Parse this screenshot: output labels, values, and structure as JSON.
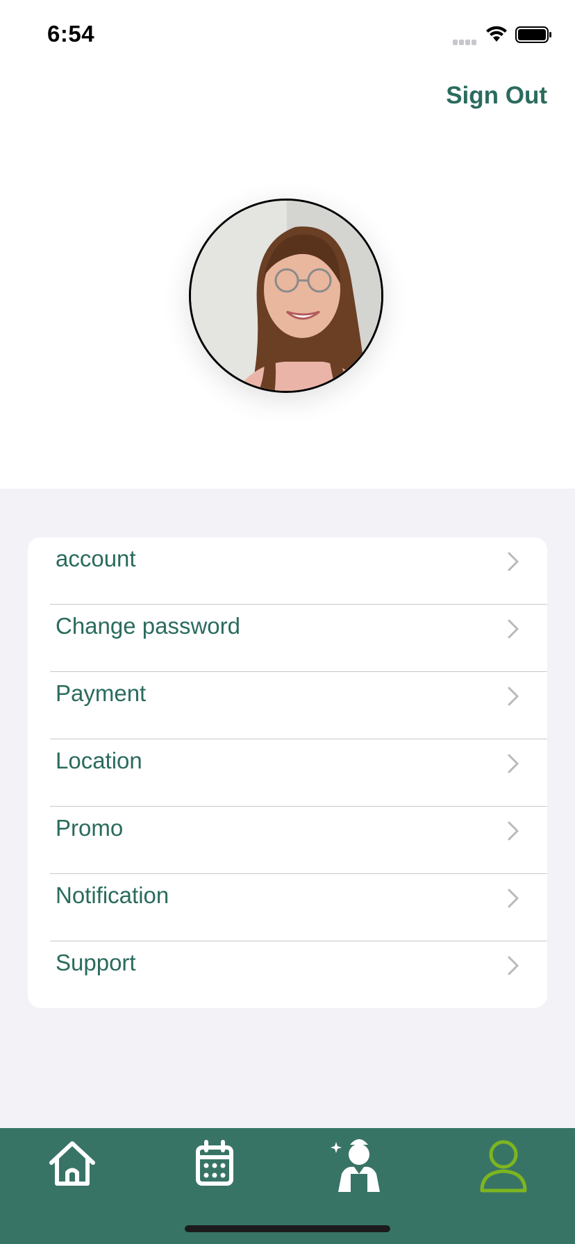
{
  "status_bar": {
    "time": "6:54"
  },
  "header": {
    "sign_out_label": "Sign Out"
  },
  "menu": {
    "items": [
      {
        "label": "account"
      },
      {
        "label": "Change password"
      },
      {
        "label": "Payment"
      },
      {
        "label": "Location"
      },
      {
        "label": "Promo"
      },
      {
        "label": "Notification"
      },
      {
        "label": "Support"
      }
    ]
  },
  "tabbar": {
    "tabs": [
      {
        "icon": "home-icon"
      },
      {
        "icon": "calendar-icon"
      },
      {
        "icon": "cleaner-icon"
      },
      {
        "icon": "profile-icon",
        "active": true
      }
    ],
    "active_color": "#7db521",
    "color": "#ffffff",
    "background": "#387466"
  },
  "colors": {
    "accent": "#2a6b5d"
  }
}
